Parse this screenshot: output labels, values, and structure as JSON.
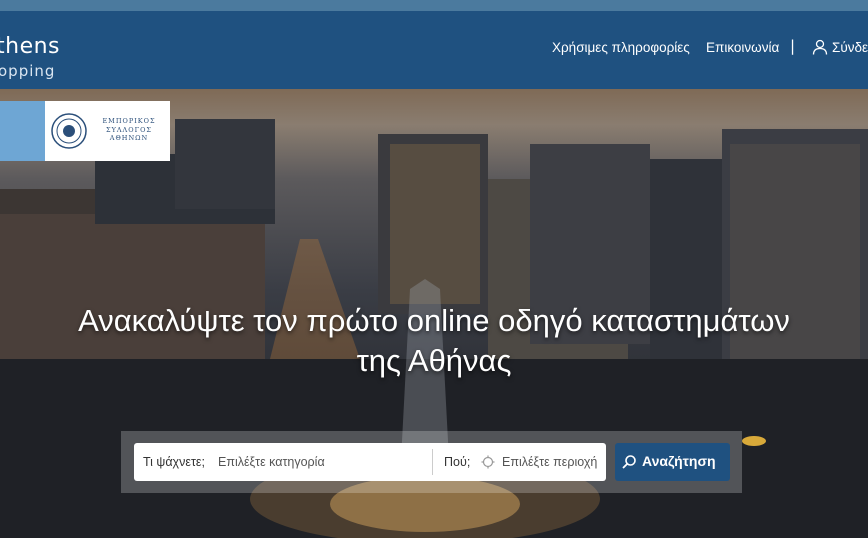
{
  "header": {
    "logo_main": "thens",
    "logo_sub": "opping",
    "nav": [
      {
        "label": "Χρήσιμες πληροφορίες"
      },
      {
        "label": "Επικοινωνία"
      },
      {
        "label": "Σύνδεση"
      }
    ],
    "separator": "|"
  },
  "partner": {
    "text": "ΕΜΠΟΡΙΚΟΣ ΣΥΛΛΟΓΟΣ ΑΘΗΝΩΝ"
  },
  "hero": {
    "headline_line1": "Ανακαλύψτε τον πρώτο online οδηγό καταστημάτων",
    "headline_line2": "της Αθήνας"
  },
  "search": {
    "what_label": "Τι ψάχνετε;",
    "what_placeholder": "Επιλέξτε κατηγορία",
    "where_label": "Πού;",
    "where_placeholder": "Επιλέξτε περιοχή",
    "button_label": "Αναζήτηση"
  },
  "colors": {
    "header_bg": "#1f5180",
    "button_bg": "#1f5180"
  }
}
